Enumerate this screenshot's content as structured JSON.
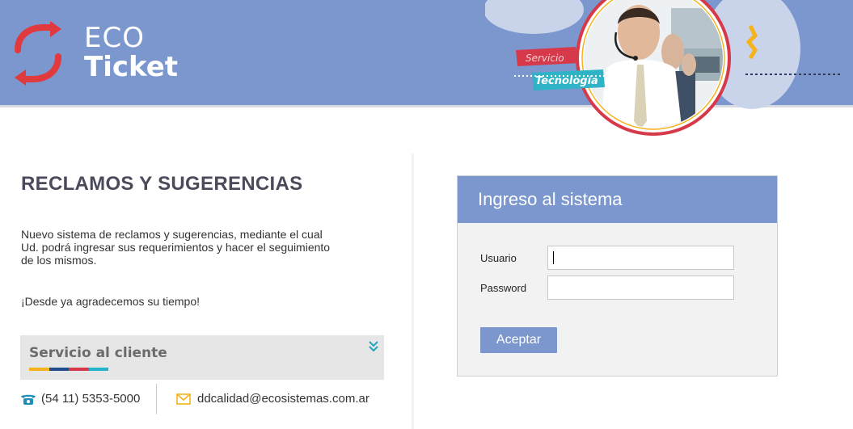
{
  "brand": {
    "line1": "ECO",
    "line2": "Ticket",
    "header_color": "#7b97ce",
    "logo_color": "#e03a3e"
  },
  "hero": {
    "badge_top": "Servicio",
    "badge_bottom": "Tecnología"
  },
  "left": {
    "title": "RECLAMOS Y SUGERENCIAS",
    "description": "Nuevo sistema de reclamos y sugerencias, mediante el cual Ud. podrá ingresar sus requerimientos y hacer el seguimiento de los mismos.",
    "thanks": "¡Desde ya agradecemos su tiempo!",
    "service": {
      "title": "Servicio al cliente",
      "stripe_colors": [
        "#f5b21b",
        "#1f4e8c",
        "#d8394a",
        "#22b5c9"
      ],
      "chevron_icon": "double-chevron-down-icon"
    },
    "contact": {
      "phone": "(54 11) 5353-5000",
      "phone_icon": "phone-icon",
      "email": "ddcalidad@ecosistemas.com.ar",
      "email_icon": "envelope-icon"
    }
  },
  "login": {
    "title": "Ingreso al sistema",
    "user_label": "Usuario",
    "user_value": "",
    "password_label": "Password",
    "password_value": "",
    "submit_label": "Aceptar"
  }
}
